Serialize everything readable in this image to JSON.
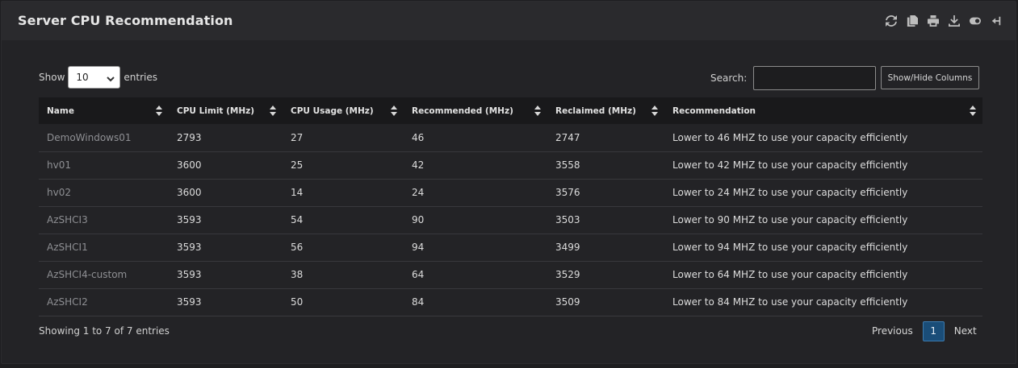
{
  "panel": {
    "title": "Server CPU Recommendation",
    "toolbar": [
      "refresh-icon",
      "copy-icon",
      "print-icon",
      "download-icon",
      "toggle-icon",
      "pin-icon"
    ]
  },
  "length_control": {
    "label_before": "Show",
    "selected": "10",
    "label_after": "entries"
  },
  "search": {
    "label": "Search:",
    "value": ""
  },
  "show_hide_label": "Show/Hide Columns",
  "table": {
    "columns": [
      "Name",
      "CPU Limit (MHz)",
      "CPU Usage (MHz)",
      "Recommended (MHz)",
      "Reclaimed (MHz)",
      "Recommendation"
    ],
    "rows": [
      [
        "DemoWindows01",
        "2793",
        "27",
        "46",
        "2747",
        "Lower to 46 MHZ to use your capacity efficiently"
      ],
      [
        "hv01",
        "3600",
        "25",
        "42",
        "3558",
        "Lower to 42 MHZ to use your capacity efficiently"
      ],
      [
        "hv02",
        "3600",
        "14",
        "24",
        "3576",
        "Lower to 24 MHZ to use your capacity efficiently"
      ],
      [
        "AzSHCI3",
        "3593",
        "54",
        "90",
        "3503",
        "Lower to 90 MHZ to use your capacity efficiently"
      ],
      [
        "AzSHCI1",
        "3593",
        "56",
        "94",
        "3499",
        "Lower to 94 MHZ to use your capacity efficiently"
      ],
      [
        "AzSHCI4-custom",
        "3593",
        "38",
        "64",
        "3529",
        "Lower to 64 MHZ to use your capacity efficiently"
      ],
      [
        "AzSHCI2",
        "3593",
        "50",
        "84",
        "3509",
        "Lower to 84 MHZ to use your capacity efficiently"
      ]
    ]
  },
  "footer": {
    "info": "Showing 1 to 7 of 7 entries",
    "previous": "Previous",
    "current_page": "1",
    "next": "Next"
  },
  "colors": {
    "accent": "#1a4d78",
    "header_bg": "#2a2a2d",
    "table_head_bg": "#19191b"
  }
}
